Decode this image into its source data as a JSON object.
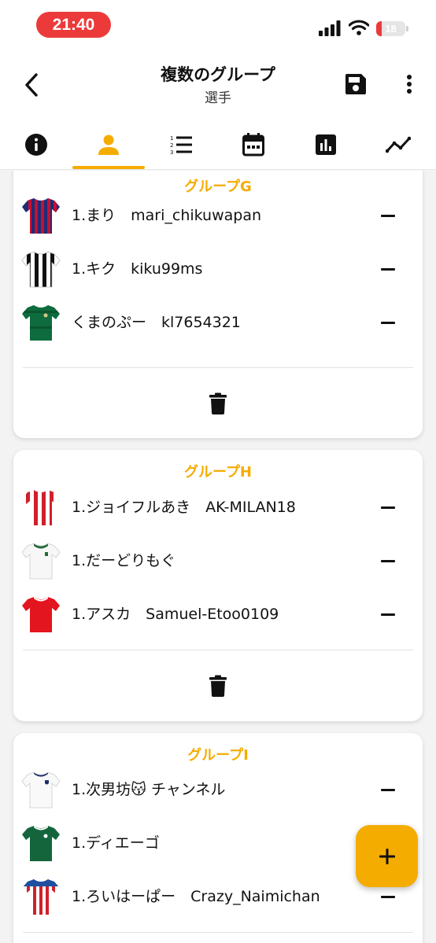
{
  "status_bar": {
    "time": "21:40",
    "battery": "18",
    "battery_level": 0.18
  },
  "header": {
    "title": "複数のグループ",
    "subtitle": "選手"
  },
  "tabs": [
    {
      "icon": "info-icon",
      "active": false
    },
    {
      "icon": "person-icon",
      "active": true
    },
    {
      "icon": "numbered-list-icon",
      "active": false
    },
    {
      "icon": "calendar-icon",
      "active": false
    },
    {
      "icon": "bar-chart-icon",
      "active": false
    },
    {
      "icon": "trend-line-icon",
      "active": false
    }
  ],
  "groups": [
    {
      "title": "グループG",
      "players": [
        {
          "name": "1.まり　mari_chikuwapan",
          "jersey": "blue-red-stripe-jersey-icon"
        },
        {
          "name": "1.キク　kiku99ms",
          "jersey": "black-white-stripe-jersey-icon"
        },
        {
          "name": "くまのぷー　kl7654321",
          "jersey": "green-jersey-icon"
        }
      ]
    },
    {
      "title": "グループH",
      "players": [
        {
          "name": "1.ジョイフルあき　AK-MILAN18",
          "jersey": "red-white-stripe-jersey-icon"
        },
        {
          "name": "1.だーどりもぐ",
          "jersey": "white-green-jersey-icon"
        },
        {
          "name": "1.アスカ　Samuel-Etoo0109",
          "jersey": "red-jersey-icon"
        }
      ]
    },
    {
      "title": "グループI",
      "players": [
        {
          "name": "1.次男坊😽 チャンネル",
          "jersey": "white-jersey-icon"
        },
        {
          "name": "1.ディエーゴ",
          "jersey": "green-jersey-icon"
        },
        {
          "name": "1.ろいはーぱー　Crazy_Naimichan",
          "jersey": "red-white-blue-stripe-jersey-icon"
        }
      ]
    }
  ],
  "colors": {
    "accent": "#f5ac00",
    "status_time": "#ec3a3a"
  }
}
